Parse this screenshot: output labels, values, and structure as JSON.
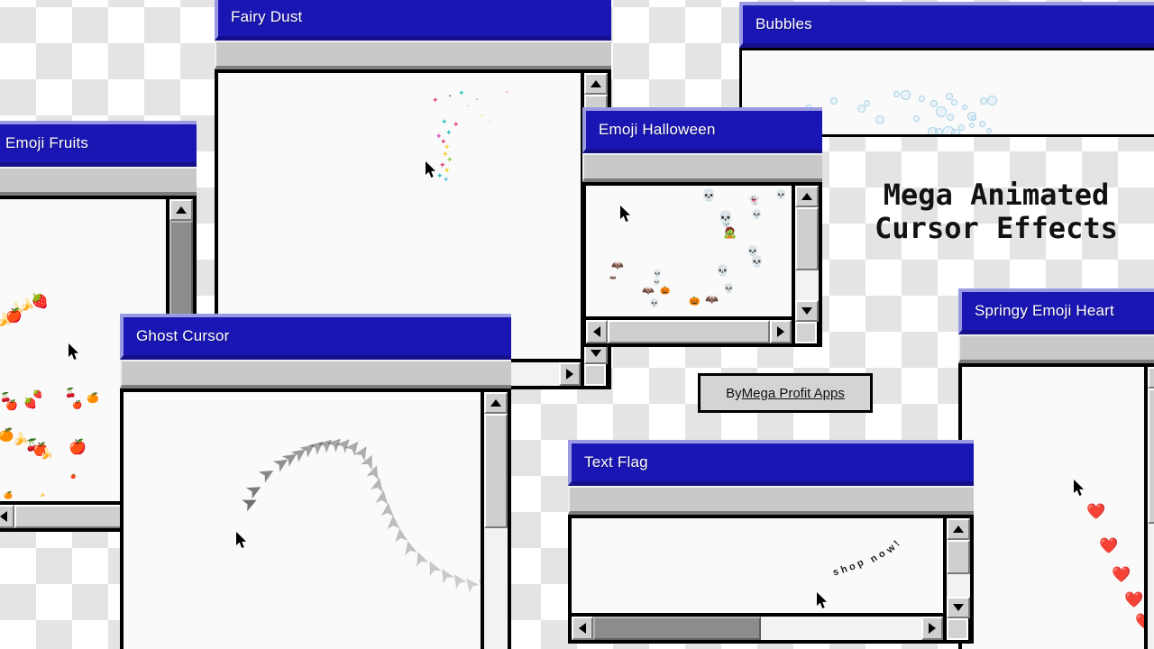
{
  "headline": {
    "line1": "Mega Animated",
    "line2": "Cursor Effects"
  },
  "byline": {
    "prefix": "By ",
    "link": "Mega Profit Apps"
  },
  "windows": [
    {
      "id": "fairy-dust",
      "title": "Fairy Dust"
    },
    {
      "id": "bubbles",
      "title": "Bubbles"
    },
    {
      "id": "emoji-fruits",
      "title": "Emoji Fruits"
    },
    {
      "id": "emoji-halloween",
      "title": "Emoji Halloween"
    },
    {
      "id": "ghost-cursor",
      "title": "Ghost Cursor"
    },
    {
      "id": "springy-emoji-heart",
      "title": "Springy Emoji Heart"
    },
    {
      "id": "text-flag",
      "title": "Text Flag"
    }
  ],
  "text_flag": {
    "trail_text": "shop now!"
  },
  "colors": {
    "title_bar": "#1a16b4",
    "title_bar_highlight": "#9a9ae2",
    "title_bar_shadow": "#14108c",
    "toolbar": "#c9c9c9",
    "window_border": "#000000",
    "canvas": "#fafafa",
    "checker_light": "#ffffff",
    "checker_dark": "#e4e4e4",
    "heart": "#e0232c",
    "bubble": "#a9d3e8"
  },
  "effects": {
    "fairy_dust_colors": [
      "#36c6bd",
      "#e04a7a",
      "#f2d23a",
      "#8fd14f",
      "#6ac5e8",
      "#d959b8"
    ],
    "fruit_glyphs": [
      "🍎",
      "🍓",
      "🍌",
      "🍊",
      "🍒"
    ],
    "halloween_glyphs": [
      "💀",
      "👻",
      "🦇",
      "🎃"
    ],
    "heart_glyph": "❤️"
  }
}
